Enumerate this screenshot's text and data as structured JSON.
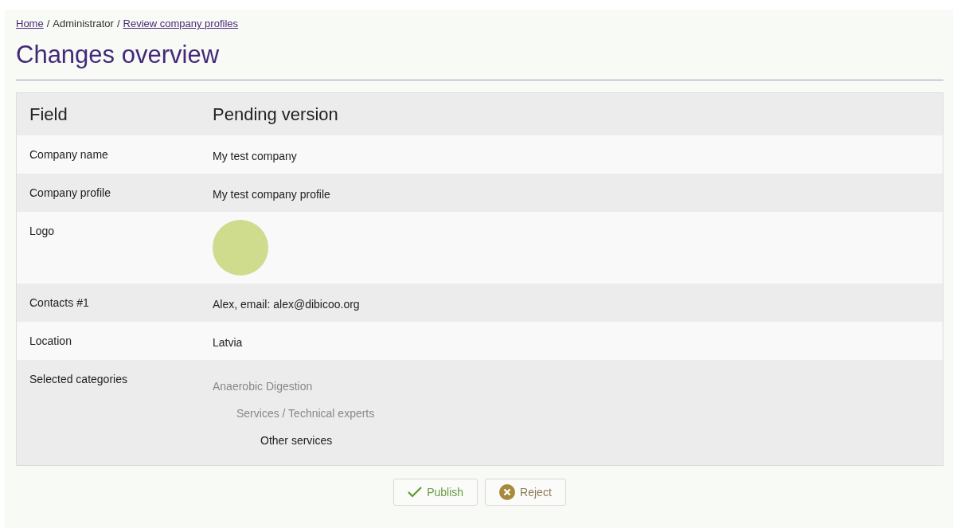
{
  "breadcrumb_separator": "/",
  "breadcrumb": [
    {
      "label": "Home",
      "kind": "link"
    },
    {
      "label": "Administrator",
      "kind": "text"
    },
    {
      "label": "Review company profiles",
      "kind": "link"
    }
  ],
  "title": "Changes overview",
  "table": {
    "columns": [
      "Field",
      "Pending version"
    ],
    "rows": [
      {
        "field": "Company name",
        "kind": "text",
        "value": "My test company"
      },
      {
        "field": "Company profile",
        "kind": "text",
        "value": "My test company profile"
      },
      {
        "field": "Logo",
        "kind": "image"
      },
      {
        "field": "Contacts #1",
        "kind": "text",
        "value": "Alex, email: alex@dibicoo.org"
      },
      {
        "field": "Location",
        "kind": "text",
        "value": "Latvia"
      },
      {
        "field": "Selected categories",
        "kind": "tree",
        "categories": [
          {
            "label": "Anaerobic Digestion",
            "children": [
              {
                "label": "Services / Technical experts",
                "children": [
                  {
                    "label": "Other services"
                  }
                ]
              }
            ]
          }
        ]
      }
    ]
  },
  "buttons": [
    {
      "label": "Publish",
      "kind": "publish"
    },
    {
      "label": "Reject",
      "kind": "reject"
    }
  ]
}
